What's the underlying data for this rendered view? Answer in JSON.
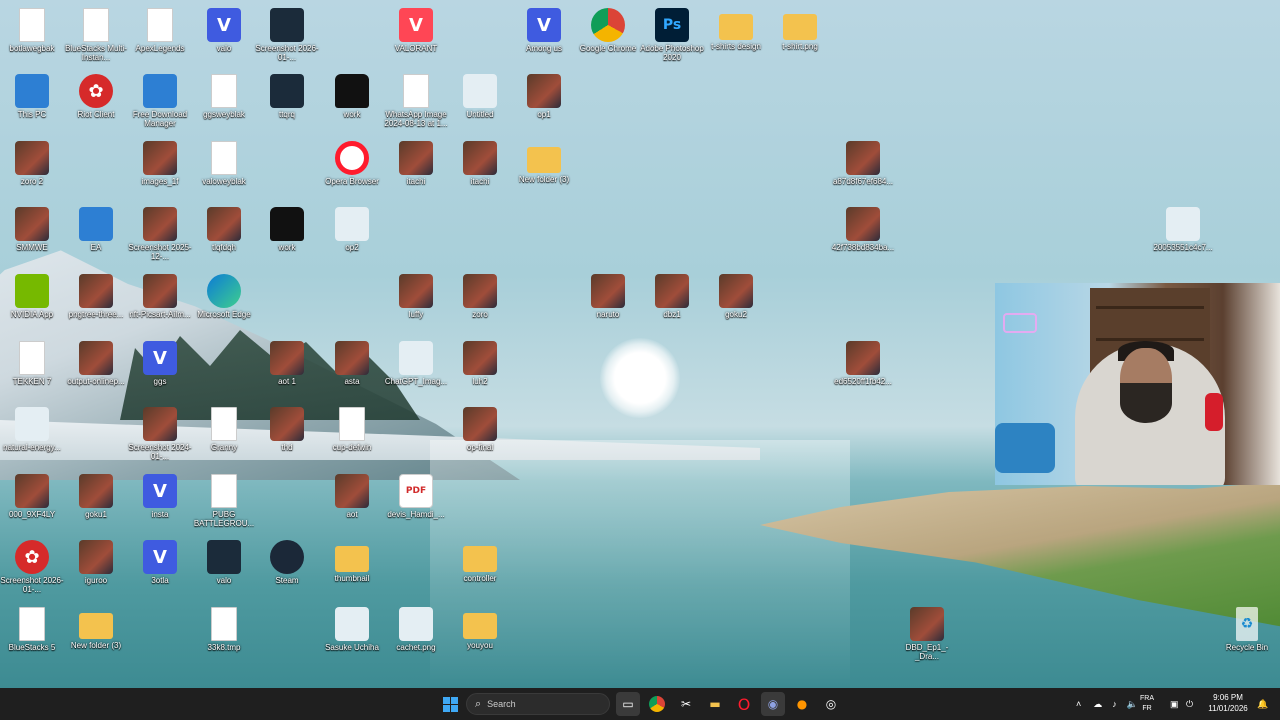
{
  "desktop": {
    "icons": [
      {
        "label": "botlawegbak",
        "kind": "file"
      },
      {
        "label": "BlueStacks Multi-Instan...",
        "kind": "file"
      },
      {
        "label": "ApexLegends",
        "kind": "file"
      },
      {
        "label": "valo",
        "kind": "v"
      },
      {
        "label": "Screenshot 2026-01-...",
        "kind": "dark"
      },
      {
        "label": "VALORANT",
        "kind": "valorant"
      },
      {
        "label": "Among us",
        "kind": "v"
      },
      {
        "label": "Google Chrome",
        "kind": "chrome"
      },
      {
        "label": "Adobe Photoshop 2020",
        "kind": "ps"
      },
      {
        "label": "t-shirts design",
        "kind": "folder"
      },
      {
        "label": "t-shirt.png",
        "kind": "folder"
      },
      {
        "label": "This PC",
        "kind": "blue"
      },
      {
        "label": "Riot Client",
        "kind": "red"
      },
      {
        "label": "Free Download Manager",
        "kind": "blue"
      },
      {
        "label": "ggsweyblak",
        "kind": "file"
      },
      {
        "label": "ttqrq",
        "kind": "dark"
      },
      {
        "label": "work",
        "kind": "shirt"
      },
      {
        "label": "WhatsApp Image 2024-08-13 at 1...",
        "kind": "file"
      },
      {
        "label": "Untitled",
        "kind": "light"
      },
      {
        "label": "op1",
        "kind": "photo"
      },
      {
        "label": "zoro 2",
        "kind": "photo"
      },
      {
        "label": "images_1f",
        "kind": "photo"
      },
      {
        "label": "valoweyblak",
        "kind": "file"
      },
      {
        "label": "Opera Browser",
        "kind": "opera"
      },
      {
        "label": "itachi",
        "kind": "photo"
      },
      {
        "label": "itachi",
        "kind": "photo"
      },
      {
        "label": "New folder (3)",
        "kind": "folder"
      },
      {
        "label": "a87d8f67ef684...",
        "kind": "photo"
      },
      {
        "label": "SMMWE",
        "kind": "photo"
      },
      {
        "label": "EA",
        "kind": "blue"
      },
      {
        "label": "Screenshot 2025-12-...",
        "kind": "photo"
      },
      {
        "label": "tlqfdqh",
        "kind": "photo"
      },
      {
        "label": "work",
        "kind": "shirt"
      },
      {
        "label": "op2",
        "kind": "light"
      },
      {
        "label": "42f738bd834ba...",
        "kind": "photo"
      },
      {
        "label": "20053551c4c7...",
        "kind": "light"
      },
      {
        "label": "NVIDIA App",
        "kind": "green"
      },
      {
        "label": "pngtree-three...",
        "kind": "photo"
      },
      {
        "label": "nft-Picsart-AiIm...",
        "kind": "photo"
      },
      {
        "label": "Microsoft Edge",
        "kind": "edge"
      },
      {
        "label": "luffy",
        "kind": "photo"
      },
      {
        "label": "zoro",
        "kind": "photo"
      },
      {
        "label": "naruto",
        "kind": "photo"
      },
      {
        "label": "dbz1",
        "kind": "photo"
      },
      {
        "label": "goku2",
        "kind": "photo"
      },
      {
        "label": "TEKKEN 7",
        "kind": "file"
      },
      {
        "label": "output-onlinep...",
        "kind": "photo"
      },
      {
        "label": "ggs",
        "kind": "v"
      },
      {
        "label": "aot 1",
        "kind": "photo"
      },
      {
        "label": "asta",
        "kind": "photo"
      },
      {
        "label": "ChatGPT_Imag...",
        "kind": "light"
      },
      {
        "label": "luh2",
        "kind": "photo"
      },
      {
        "label": "ed6520ff1fb42...",
        "kind": "photo"
      },
      {
        "label": "natural-energy...",
        "kind": "light"
      },
      {
        "label": "Screenshot 2024-01-...",
        "kind": "photo"
      },
      {
        "label": "Granny",
        "kind": "file"
      },
      {
        "label": "thd",
        "kind": "photo"
      },
      {
        "label": "cup-defwin",
        "kind": "file"
      },
      {
        "label": "op-final",
        "kind": "photo"
      },
      {
        "label": "000_9XF4LY",
        "kind": "photo"
      },
      {
        "label": "goku1",
        "kind": "photo"
      },
      {
        "label": "insta",
        "kind": "v"
      },
      {
        "label": "PUBG BATTLEGROU...",
        "kind": "file"
      },
      {
        "label": "aot",
        "kind": "photo"
      },
      {
        "label": "devis_Hamdi_...",
        "kind": "pdf"
      },
      {
        "label": "Screenshot 2026-01-...",
        "kind": "red"
      },
      {
        "label": "iguroo",
        "kind": "photo"
      },
      {
        "label": "3otla",
        "kind": "v"
      },
      {
        "label": "valo",
        "kind": "dark"
      },
      {
        "label": "Steam",
        "kind": "steam"
      },
      {
        "label": "thumbnail",
        "kind": "folder"
      },
      {
        "label": "controller",
        "kind": "folder"
      },
      {
        "label": "BlueStacks 5",
        "kind": "file"
      },
      {
        "label": "New folder (3)",
        "kind": "folder"
      },
      {
        "label": "33k8.tmp",
        "kind": "file"
      },
      {
        "label": "Sasuke Uchiha",
        "kind": "light"
      },
      {
        "label": "cachet.png",
        "kind": "light"
      },
      {
        "label": "youyou",
        "kind": "folder"
      },
      {
        "label": "DBD_Ep1_-_Dra...",
        "kind": "photo"
      },
      {
        "label": "Recycle Bin",
        "kind": "recycle"
      }
    ]
  },
  "taskbar": {
    "search_label": "Search",
    "tray_lang_top": "FRA",
    "tray_lang_bottom": "FR",
    "time": "9:06 PM",
    "date": "11/01/2026"
  }
}
